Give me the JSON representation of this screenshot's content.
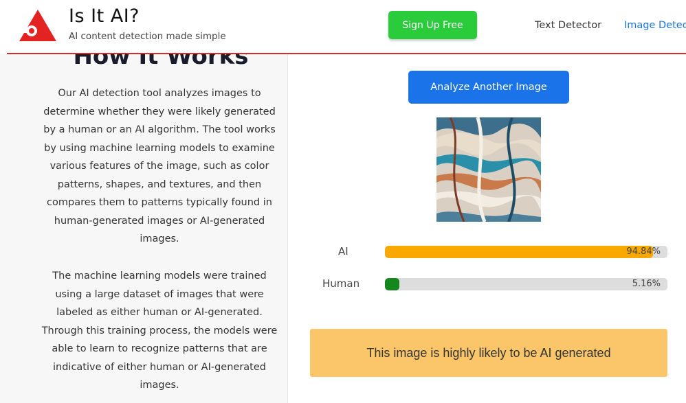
{
  "header": {
    "title": "Is It AI?",
    "tagline": "AI content detection made simple",
    "signup_label": "Sign Up Free",
    "nav": {
      "text_detector": "Text Detector",
      "image_detector": "Image Detector"
    },
    "colors": {
      "logo": "#e32222",
      "signup": "#2bcc3c",
      "divider": "#d62b2b"
    }
  },
  "how_it_works": {
    "title": "How It Works",
    "paragraph_1": "Our AI detection tool analyzes images to determine whether they were likely generated by a human or an AI algorithm. The tool works by using machine learning models to examine various features of the image, such as color patterns, shapes, and textures, and then compares them to patterns typically found in human-generated images or AI-generated images.",
    "paragraph_2": "The machine learning models were trained using a large dataset of images that were labeled as either human or AI-generated. Through this training process, the models were able to learn to recognize patterns that are indicative of either human or AI-generated images."
  },
  "result": {
    "analyze_label": "Analyze Another Image",
    "bars": [
      {
        "label": "AI",
        "percent_text": "94.84%",
        "value": 94.84,
        "color": "#f9a800"
      },
      {
        "label": "Human",
        "percent_text": "5.16%",
        "value": 5.16,
        "color": "#14871d"
      }
    ],
    "verdict": "This image is highly likely to be AI generated"
  }
}
